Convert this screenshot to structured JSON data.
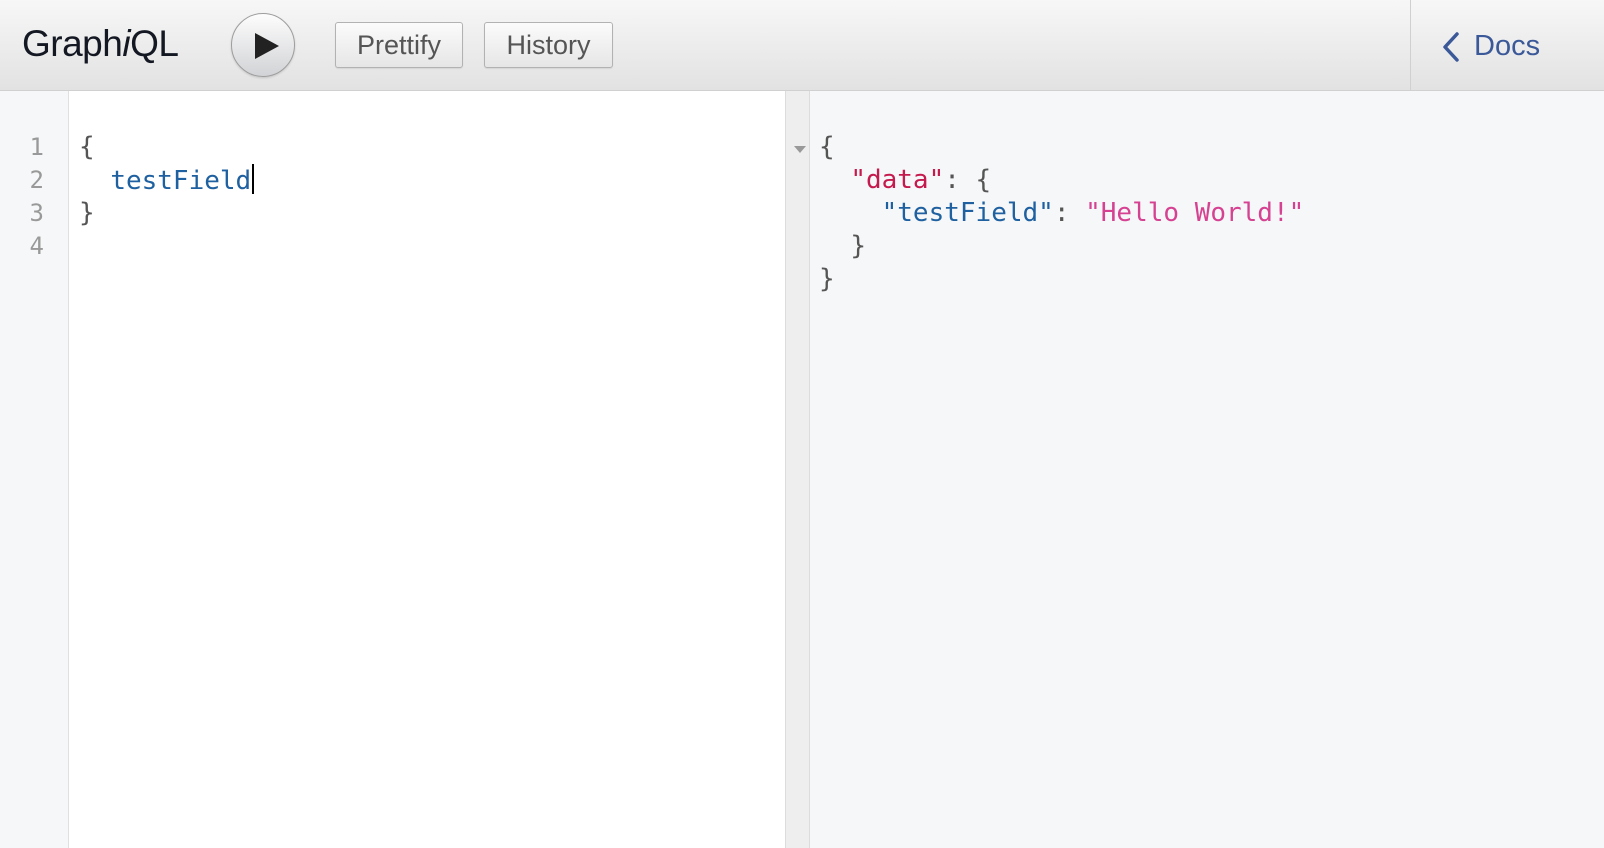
{
  "topbar": {
    "title_prefix": "Graph",
    "title_italic": "i",
    "title_suffix": "QL",
    "run_icon": "play-icon",
    "prettify_label": "Prettify",
    "history_label": "History",
    "docs_label": "Docs",
    "docs_icon": "chevron-left-icon"
  },
  "query_editor": {
    "line_numbers": [
      "1",
      "2",
      "3",
      "4"
    ],
    "lines": {
      "open_brace": "{",
      "field_indent": "  ",
      "field": "testField",
      "close_brace": "}"
    }
  },
  "result_viewer": {
    "fold_icon": "fold-triangle-icon",
    "open_brace": "{",
    "data_key": "\"data\"",
    "data_sep": ": {",
    "test_key": "\"testField\"",
    "test_sep": ": ",
    "test_value": "\"Hello World!\"",
    "inner_close": "}",
    "outer_close": "}"
  },
  "colors": {
    "accent": "#3b5998",
    "field": "#1f61a0",
    "data_key": "#c41a4e",
    "string": "#d64292"
  }
}
